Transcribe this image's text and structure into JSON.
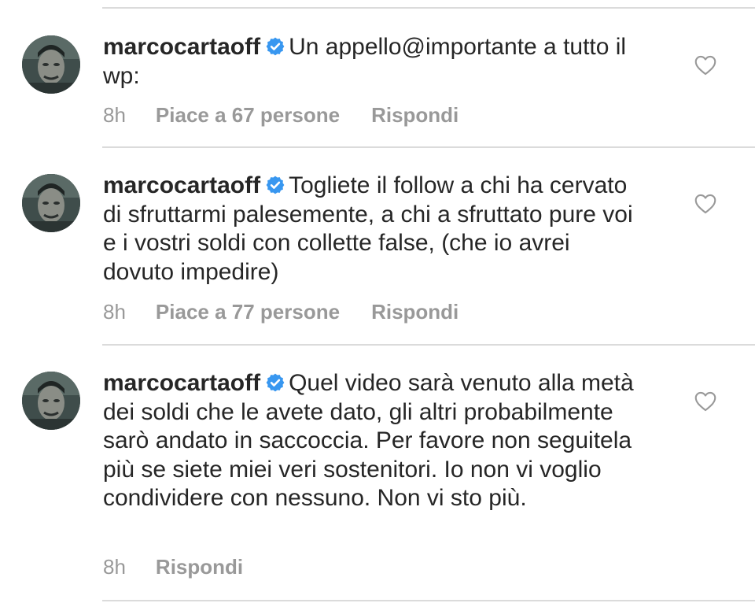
{
  "comments": [
    {
      "username": "marcocartaoff",
      "verified": true,
      "text": "Un appello@importante a tutto il wp:",
      "time": "8h",
      "likes": "Piace a 67 persone",
      "reply": "Rispondi"
    },
    {
      "username": "marcocartaoff",
      "verified": true,
      "text": "Togliete il follow a chi ha cervato di sfruttarmi palesemente, a chi a sfruttato pure voi e i vostri soldi con collette false, (che io avrei dovuto impedire)",
      "time": "8h",
      "likes": "Piace a 77 persone",
      "reply": "Rispondi"
    },
    {
      "username": "marcocartaoff",
      "verified": true,
      "text": "Quel video sarà venuto alla metà dei soldi che le avete dato, gli altri probabilmente sarò andato in saccoccia. Per favore non seguitela più se siete miei veri sostenitori. Io non vi voglio condividere con nessuno. Non vi sto più.",
      "time": "8h",
      "reply": "Rispondi"
    }
  ],
  "colors": {
    "text": "#262626",
    "meta": "#999999",
    "verified_badge": "#3897f0",
    "divider": "#dbdbdb"
  },
  "icons": {
    "verified": "verified-badge-icon",
    "like": "heart-outline-icon"
  }
}
